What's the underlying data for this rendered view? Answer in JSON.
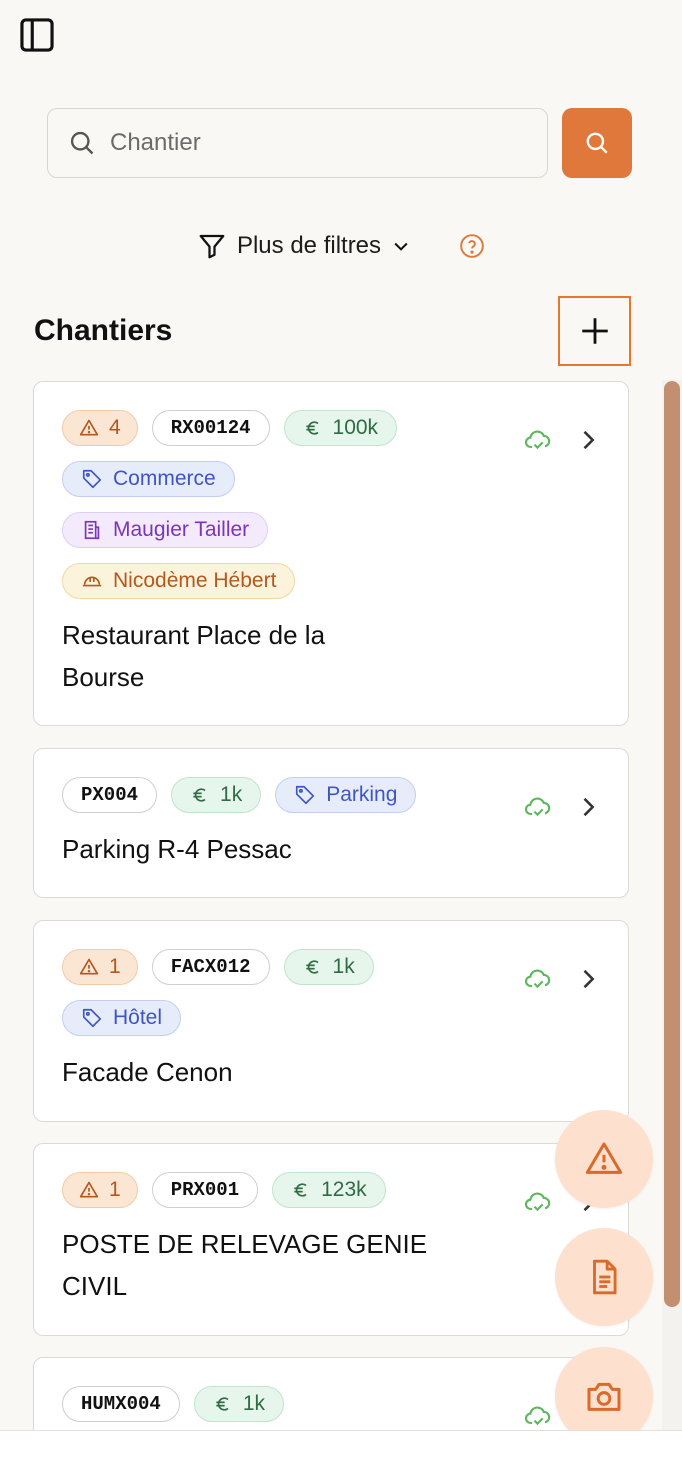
{
  "search": {
    "placeholder": "Chantier"
  },
  "filters": {
    "label": "Plus de filtres"
  },
  "section": {
    "title": "Chantiers"
  },
  "colors": {
    "accent": "#e0773b",
    "fab_bg": "#fde0cd",
    "cloud_ok": "#5cb85c"
  },
  "cards": [
    {
      "alerts": "4",
      "code": "RX00124",
      "amount": "100k",
      "category": "Commerce",
      "client": "Maugier Tailler",
      "manager": "Nicodème Hébert",
      "title_line1": "Restaurant Place de la",
      "title_line2": "Bourse"
    },
    {
      "code": "PX004",
      "amount": "1k",
      "category": "Parking",
      "title_line1": "Parking R-4 Pessac"
    },
    {
      "alerts": "1",
      "code": "FACX012",
      "amount": "1k",
      "category": "Hôtel",
      "title_line1": "Facade Cenon"
    },
    {
      "alerts": "1",
      "code": "PRX001",
      "amount": "123k",
      "title_line1": "POSTE DE RELEVAGE GENIE",
      "title_line2": "CIVIL"
    },
    {
      "code": "HUMX004",
      "amount": "1k"
    }
  ],
  "icons": {
    "sidebar": "sidebar-icon",
    "search": "search-icon",
    "filter": "filter-icon",
    "help": "help-circle-icon",
    "add": "plus-icon",
    "alert": "warning-triangle-icon",
    "euro": "euro-icon",
    "tag": "tag-icon",
    "building": "building-icon",
    "helmet": "helmet-icon",
    "cloud": "cloud-check-icon",
    "chevron": "chevron-right-icon",
    "document": "document-icon",
    "camera": "camera-icon"
  }
}
